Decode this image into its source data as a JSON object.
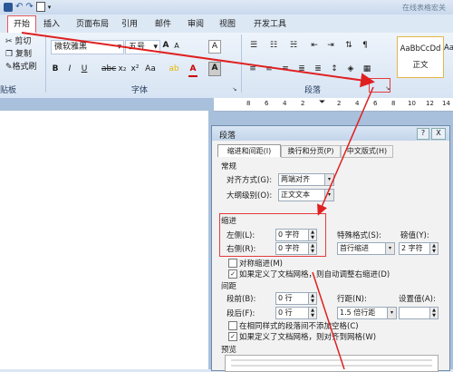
{
  "titlebar": {
    "right_text": "在线表格宏关"
  },
  "tabs": [
    "开始",
    "插入",
    "页面布局",
    "引用",
    "邮件",
    "审阅",
    "视图",
    "开发工具"
  ],
  "clipboard": {
    "cut": "剪切",
    "copy": "复制",
    "format_painter": "格式刷",
    "group_label": "贴板"
  },
  "font": {
    "name": "微软雅黑",
    "size": "五号",
    "group_label": "字体",
    "bold": "B",
    "italic": "I",
    "underline": "U",
    "grow": "A",
    "shrink": "A",
    "clear": "A",
    "color": "A",
    "big_a": "A"
  },
  "paragraph": {
    "group_label": "段落"
  },
  "styles": {
    "sample": "AaBbCcDd",
    "name": "正文",
    "sample2": "Aa"
  },
  "ruler_ticks": [
    "8",
    "6",
    "4",
    "2",
    "",
    "2",
    "4",
    "6",
    "8",
    "10",
    "12",
    "14"
  ],
  "dialog": {
    "title": "段落",
    "help": "?",
    "close": "X",
    "tabs": [
      "缩进和间距(I)",
      "换行和分页(P)",
      "中文版式(H)"
    ],
    "general": {
      "header": "常规",
      "align_label": "对齐方式(G):",
      "align_value": "两端对齐",
      "outline_label": "大纲级别(O):",
      "outline_value": "正文文本"
    },
    "indent": {
      "header": "缩进",
      "left_label": "左侧(L):",
      "left_value": "0 字符",
      "right_label": "右侧(R):",
      "right_value": "0 字符",
      "special_label": "特殊格式(S):",
      "special_value": "首行缩进",
      "by_label": "磅值(Y):",
      "by_value": "2 字符",
      "mirror": "对称缩进(M)",
      "auto_adjust": "如果定义了文档网格，则自动调整右缩进(D)"
    },
    "spacing": {
      "header": "间距",
      "before_label": "段前(B):",
      "before_value": "0 行",
      "after_label": "段后(F):",
      "after_value": "0 行",
      "line_label": "行距(N):",
      "line_value": "1.5 倍行距",
      "at_label": "设置值(A):",
      "at_value": "",
      "no_space": "在相同样式的段落间不添加空格(C)",
      "snap": "如果定义了文档网格，则对齐到网格(W)"
    },
    "preview": {
      "header": "预览"
    }
  }
}
